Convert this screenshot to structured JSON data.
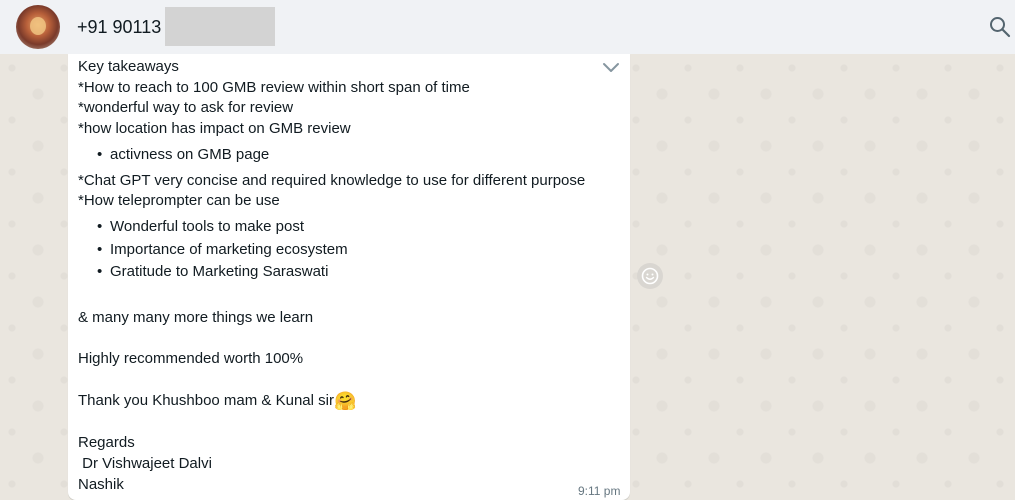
{
  "header": {
    "contact_name": "+91 90113 8",
    "search_icon": "search-icon",
    "avatar_icon": "avatar"
  },
  "message": {
    "lines": [
      "Key takeaways",
      "*How to reach to 100 GMB review within short span of time",
      "*wonderful way to ask for review",
      "*how location has impact on GMB review"
    ],
    "bullets_1": [
      "activness on GMB page"
    ],
    "lines_2": [
      "*Chat GPT very concise and required knowledge to use for different purpose",
      "*How teleprompter can be use"
    ],
    "bullets_2": [
      "Wonderful tools to make post",
      "Importance of marketing ecosystem",
      "Gratitude to Marketing Saraswati"
    ],
    "more": "& many many more things we learn",
    "recommend": "Highly recommended worth 100%",
    "thanks": "Thank you Khushboo mam & Kunal sir",
    "thanks_emoji": "🤗",
    "regards": "Regards",
    "sender_name": " Dr Vishwajeet Dalvi",
    "sender_city": "Nashik",
    "time": "9:11 pm",
    "bullet_glyph": "•"
  },
  "icons": {
    "menu": "chevron-down-icon",
    "react": "smiley-icon"
  },
  "colors": {
    "header_bg": "#f0f2f5",
    "wallpaper": "#eae6df",
    "bubble": "#ffffff",
    "meta_text": "#667781"
  }
}
